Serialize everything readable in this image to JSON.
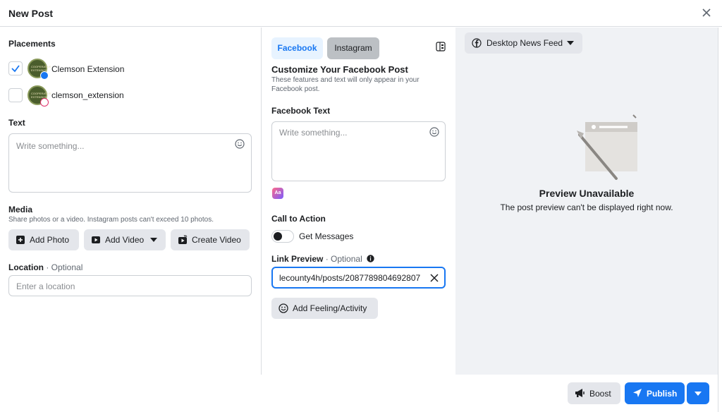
{
  "header": {
    "title": "New Post"
  },
  "left": {
    "placements_label": "Placements",
    "accounts": [
      {
        "name": "Clemson Extension",
        "checked": true,
        "network": "facebook"
      },
      {
        "name": "clemson_extension",
        "checked": false,
        "network": "instagram"
      }
    ],
    "text_label": "Text",
    "text_placeholder": "Write something...",
    "media_label": "Media",
    "media_sub": "Share photos or a video. Instagram posts can't exceed 10 photos.",
    "add_photo": "Add Photo",
    "add_video": "Add Video",
    "create_video": "Create Video",
    "location_label": "Location",
    "location_optional": "· Optional",
    "location_placeholder": "Enter a location"
  },
  "middle": {
    "tabs": [
      {
        "label": "Facebook",
        "active": true
      },
      {
        "label": "Instagram",
        "active": false
      }
    ],
    "customize_title": "Customize Your Facebook Post",
    "customize_sub_1": "These features and text will only appear in your",
    "customize_sub_2": "Facebook post.",
    "fb_text_label": "Facebook Text",
    "fb_text_placeholder": "Write something...",
    "cta_label": "Call to Action",
    "cta_toggle_label": "Get Messages",
    "cta_toggle_on": false,
    "link_label": "Link Preview",
    "link_optional": "· Optional",
    "link_value": "lecounty4h/posts/2087789804692807",
    "feeling_button": "Add Feeling/Activity"
  },
  "right": {
    "feed_dropdown": "Desktop News Feed",
    "preview_title": "Preview Unavailable",
    "preview_sub": "The post preview can't be displayed right now."
  },
  "footer": {
    "boost": "Boost",
    "publish": "Publish"
  },
  "colors": {
    "primary": "#1877f2",
    "tab_active_bg": "#e7f3ff",
    "preview_bg": "#f0f2f5"
  }
}
